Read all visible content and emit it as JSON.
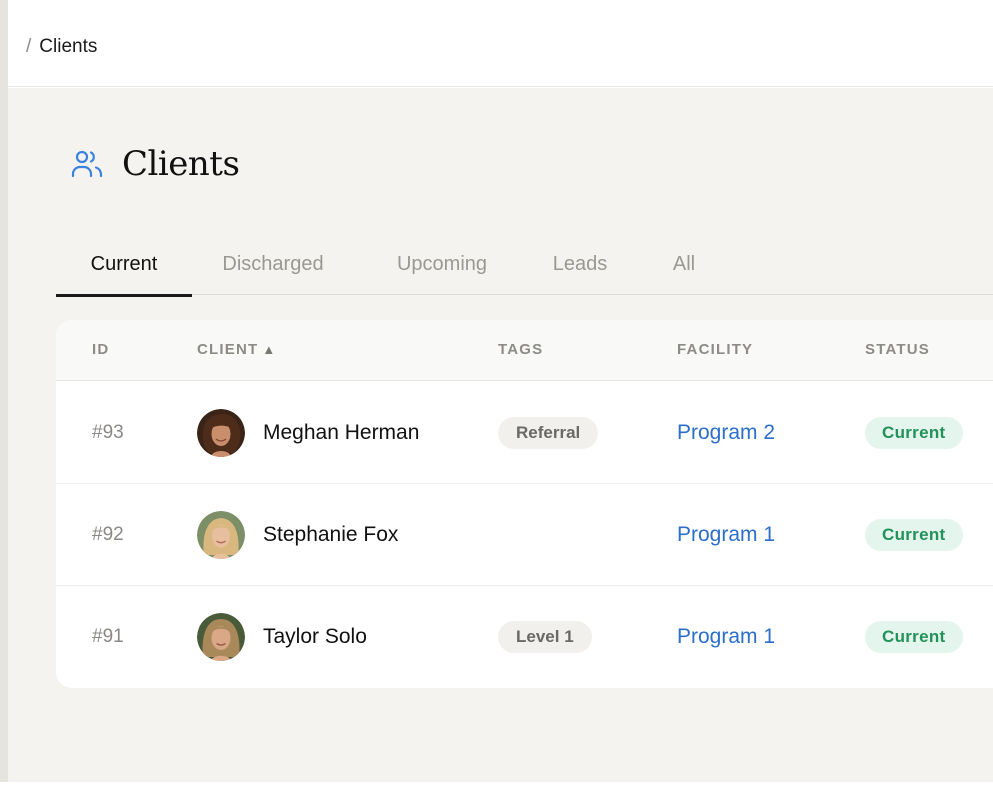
{
  "breadcrumb": {
    "separator": "/",
    "current": "Clients"
  },
  "page": {
    "title": "Clients",
    "icon": "users-icon",
    "accent_color": "#3b82e0"
  },
  "tabs": [
    {
      "label": "Current",
      "active": true
    },
    {
      "label": "Discharged",
      "active": false
    },
    {
      "label": "Upcoming",
      "active": false
    },
    {
      "label": "Leads",
      "active": false
    },
    {
      "label": "All",
      "active": false
    }
  ],
  "table": {
    "columns": {
      "id": "ID",
      "client": "CLIENT",
      "client_sort_indicator": "▲",
      "tags": "TAGS",
      "facility": "FACILITY",
      "status": "STATUS"
    },
    "rows": [
      {
        "id": "#93",
        "name": "Meghan Herman",
        "tag": "Referral",
        "facility": "Program 2",
        "status": "Current",
        "avatar": "avatar-photo"
      },
      {
        "id": "#92",
        "name": "Stephanie Fox",
        "tag": "",
        "facility": "Program 1",
        "status": "Current",
        "avatar": "avatar-photo"
      },
      {
        "id": "#91",
        "name": "Taylor Solo",
        "tag": "Level 1",
        "facility": "Program 1",
        "status": "Current",
        "avatar": "avatar-photo"
      }
    ]
  },
  "colors": {
    "link": "#2b6fcb",
    "status_bg": "#e3f5ec",
    "status_text": "#23915a",
    "tag_bg": "#f1f0ec",
    "content_bg": "#f4f3ef"
  }
}
